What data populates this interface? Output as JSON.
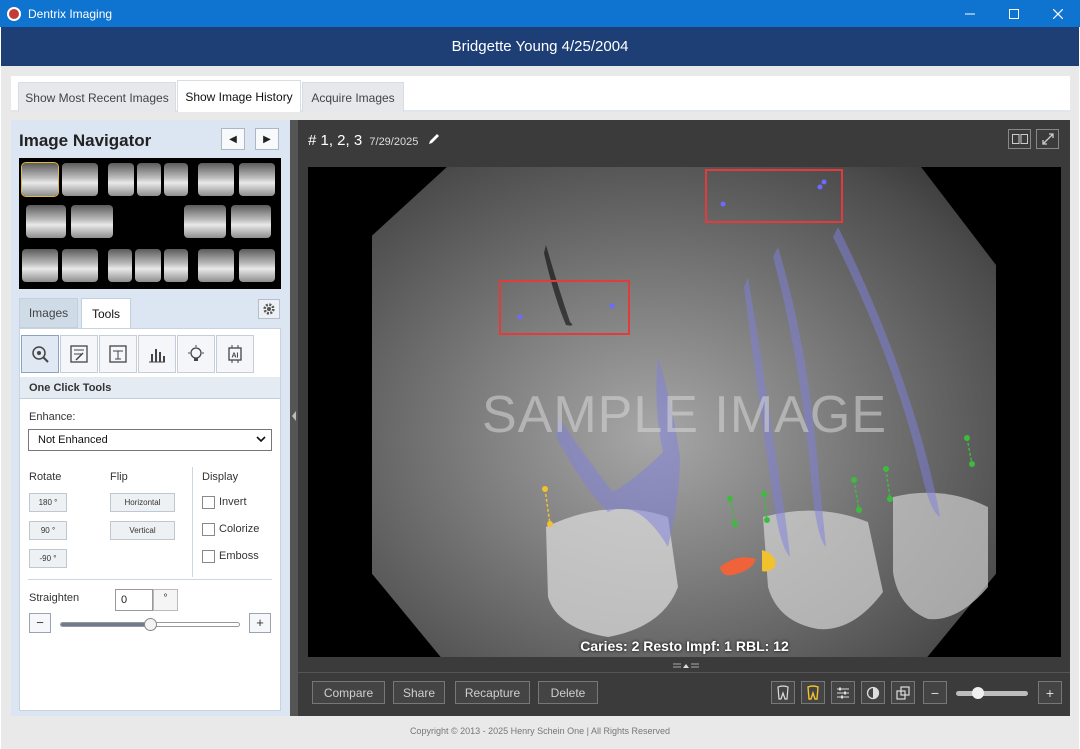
{
  "window": {
    "title": "Dentrix Imaging",
    "buttons": [
      "minimize",
      "maximize",
      "close"
    ]
  },
  "patient": {
    "header": "Bridgette Young 4/25/2004"
  },
  "top_tabs": [
    {
      "label": "Show Most Recent Images",
      "active": false
    },
    {
      "label": "Show Image History",
      "active": true
    },
    {
      "label": "Acquire Images",
      "active": false
    }
  ],
  "navigator": {
    "title": "Image Navigator",
    "prev_icon": "triangle-left",
    "next_icon": "triangle-right"
  },
  "side_tabs": [
    {
      "label": "Images",
      "active": false
    },
    {
      "label": "Tools",
      "active": true
    }
  ],
  "tools": {
    "section_title": "One Click Tools",
    "enhance_label": "Enhance:",
    "enhance_value": "Not Enhanced",
    "rotate_label": "Rotate",
    "rotate_buttons": [
      "180 °",
      "90 °",
      "-90 °"
    ],
    "flip_label": "Flip",
    "flip_buttons": [
      "Horizontal",
      "Vertical"
    ],
    "display_label": "Display",
    "display_options": [
      {
        "label": "Invert",
        "checked": false
      },
      {
        "label": "Colorize",
        "checked": false
      },
      {
        "label": "Emboss",
        "checked": false
      }
    ],
    "straighten_label": "Straighten",
    "straighten_value": "0",
    "straighten_unit": "°",
    "straighten_level": 0.5,
    "minus": "−",
    "plus": "+"
  },
  "viewer": {
    "title": "# 1, 2, 3",
    "date": "7/29/2025",
    "watermark": "SAMPLE IMAGE",
    "caption": "Caries: 2 Resto Impf: 1 RBL: 12",
    "annotation_colors": {
      "box": "#e23b3b",
      "caries": "#f0623a",
      "restoration": "#f2c12e",
      "rbl": "#3dbb3d",
      "root": "#7f7fe0"
    }
  },
  "footer_buttons": [
    "Compare",
    "Share",
    "Recapture",
    "Delete"
  ],
  "footer_icons": [
    "tooth-outline-icon",
    "tooth-yellow-icon",
    "adjust-sliders-icon",
    "contrast-icon",
    "layers-icon"
  ],
  "zoom": {
    "minus": "−",
    "plus": "+",
    "level": 0.3
  },
  "copyright": "Copyright © 2013 - 2025 Henry Schein One | All Rights Reserved"
}
